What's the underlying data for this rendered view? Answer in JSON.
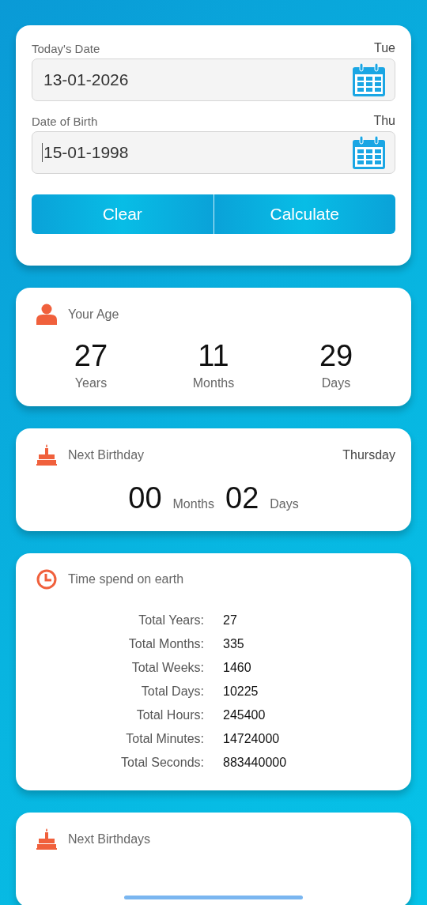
{
  "date_form": {
    "fields": [
      {
        "label": "Today's Date",
        "weekday": "Tue",
        "value": "13-01-2026",
        "focused": false
      },
      {
        "label": "Date of Birth",
        "weekday": "Thu",
        "value": "15-01-1998",
        "focused": true
      }
    ],
    "buttons": [
      "Clear",
      "Calculate"
    ]
  },
  "age": {
    "title": "Your Age",
    "parts": [
      {
        "value": "27",
        "unit": "Years"
      },
      {
        "value": "11",
        "unit": "Months"
      },
      {
        "value": "29",
        "unit": "Days"
      }
    ]
  },
  "next_birthday": {
    "title": "Next Birthday",
    "weekday": "Thursday",
    "parts": [
      {
        "value": "00",
        "unit": "Months"
      },
      {
        "value": "02",
        "unit": "Days"
      }
    ]
  },
  "time_on_earth": {
    "title": "Time spend on earth",
    "rows": [
      {
        "label": "Total Years:",
        "value": "27"
      },
      {
        "label": "Total Months:",
        "value": "335"
      },
      {
        "label": "Total Weeks:",
        "value": "1460"
      },
      {
        "label": "Total Days:",
        "value": "10225"
      },
      {
        "label": "Total Hours:",
        "value": "245400"
      },
      {
        "label": "Total Minutes:",
        "value": "14724000"
      },
      {
        "label": "Total Seconds:",
        "value": "883440000"
      }
    ]
  },
  "next_birthdays": {
    "title": "Next Birthdays"
  }
}
